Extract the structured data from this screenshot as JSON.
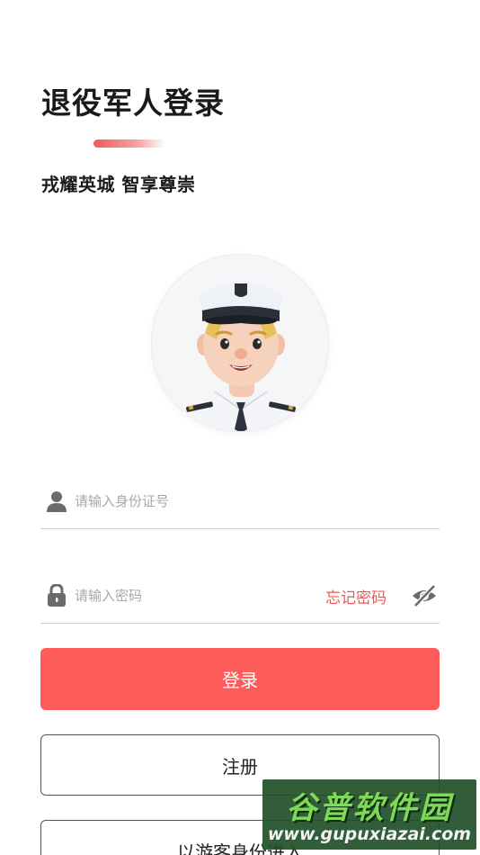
{
  "header": {
    "title": "退役军人登录",
    "subtitle": "戎耀英城 智享尊崇"
  },
  "avatar": {
    "icon": "sailor-avatar-icon"
  },
  "form": {
    "id_field": {
      "placeholder": "请输入身份证号",
      "value": "",
      "icon": "user-icon"
    },
    "password_field": {
      "placeholder": "请输入密码",
      "value": "",
      "icon": "lock-icon"
    },
    "forgot_label": "忘记密码",
    "visibility_icon": "eye-off-icon"
  },
  "buttons": {
    "login_label": "登录",
    "register_label": "注册",
    "guest_label": "以游客身份进入"
  },
  "watermark": {
    "title": "谷普软件园",
    "url": "www.gupuxiazai.com"
  },
  "colors": {
    "accent": "#fe5b5b",
    "forgot_text": "#e85a5a",
    "watermark_bg": "#205028",
    "watermark_title": "#7ed957"
  }
}
